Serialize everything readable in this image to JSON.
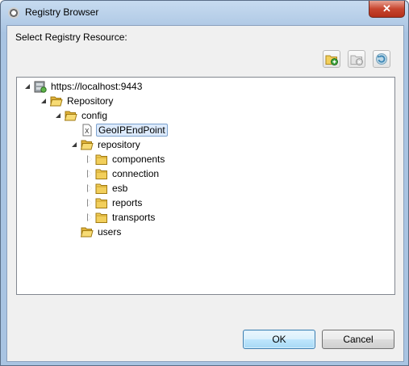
{
  "window": {
    "title": "Registry Browser",
    "close_glyph": "✕"
  },
  "dialog": {
    "prompt": "Select Registry Resource:"
  },
  "toolbar": {
    "buttons": [
      {
        "name": "add-resource-button",
        "icon": "folder-add-icon"
      },
      {
        "name": "remove-resource-button",
        "icon": "folder-remove-icon"
      },
      {
        "name": "refresh-button",
        "icon": "refresh-icon"
      }
    ]
  },
  "tree": {
    "root": "https://localhost:9443",
    "repository": "Repository",
    "config": "config",
    "geoip": "GeoIPEndPoint",
    "repo_folder": "repository",
    "components": "components",
    "connection": "connection",
    "esb": "esb",
    "reports": "reports",
    "transports": "transports",
    "users": "users"
  },
  "buttons": {
    "ok": "OK",
    "cancel": "Cancel"
  },
  "colors": {
    "selection": "#dceafc",
    "folder": "#f2cf5b",
    "ok_border": "#3c7fb1"
  }
}
